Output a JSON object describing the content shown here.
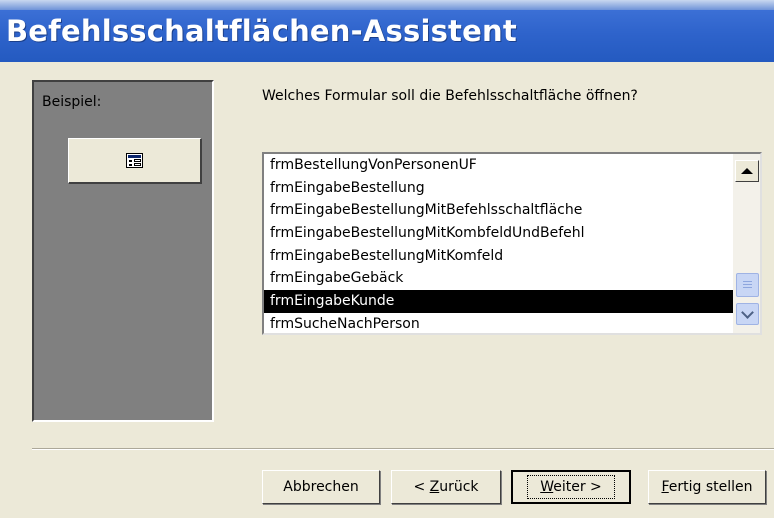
{
  "window": {
    "title": "Befehlsschaltflächen-Assistent"
  },
  "sample": {
    "label": "Beispiel:",
    "button_icon": "form-icon"
  },
  "question": "Welches Formular soll die Befehlsschaltfläche öffnen?",
  "form_list": {
    "items": [
      "frmBestellungVonPersonenUF",
      "frmEingabeBestellung",
      "frmEingabeBestellungMitBefehlsschaltfläche",
      "frmEingabeBestellungMitKombfeldUndBefehl",
      "frmEingabeBestellungMitKomfeld",
      "frmEingabeGebäck",
      "frmEingabeKunde",
      "frmSucheNachPerson"
    ],
    "selected": "frmEingabeKunde"
  },
  "buttons": {
    "cancel": "Abbrechen",
    "back_prefix": "< ",
    "back_mnemonic": "Z",
    "back_rest": "urück",
    "next_mnemonic": "W",
    "next_rest": "eiter >",
    "finish_mnemonic": "F",
    "finish_rest": "ertig stellen"
  },
  "colors": {
    "title_bar": "#2e63cb",
    "selection": "#000000",
    "sample_panel": "#808080"
  }
}
